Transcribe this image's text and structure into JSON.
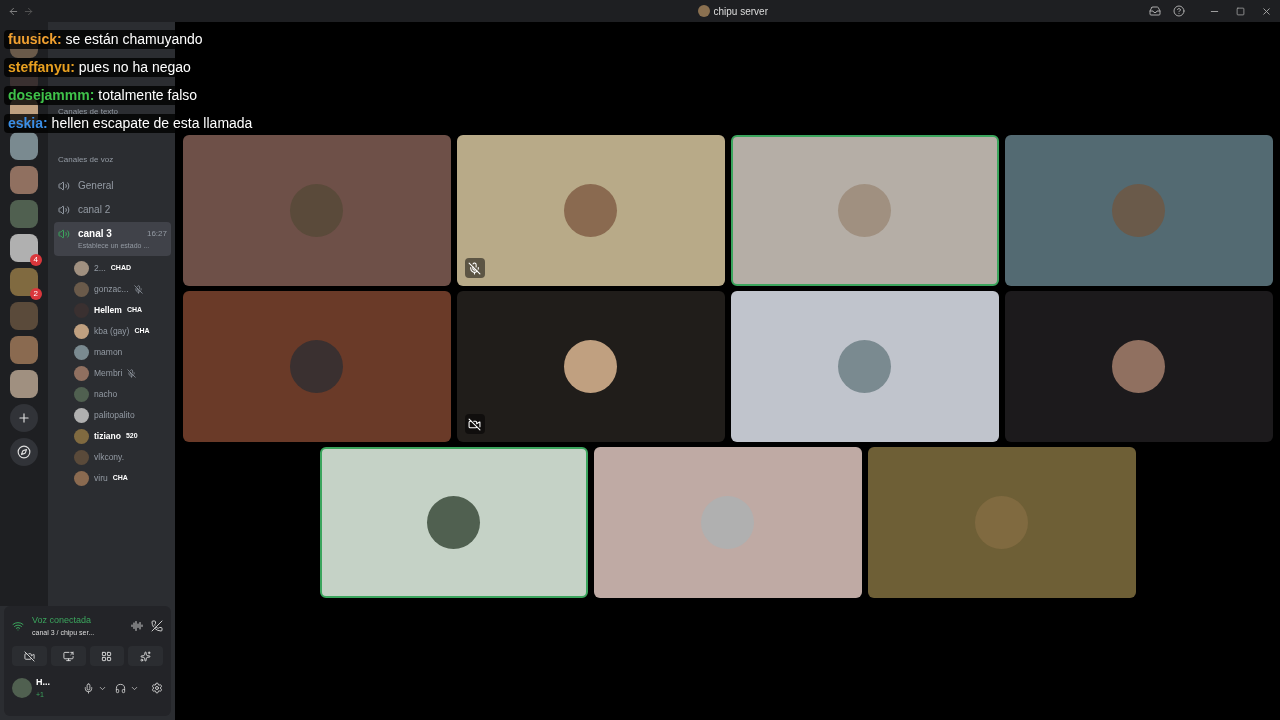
{
  "window": {
    "title": "chipu server"
  },
  "chat_overlay": [
    {
      "user": "fuusick:",
      "color": "#f0a030",
      "message": "se están chamuyando"
    },
    {
      "user": "steffanyu:",
      "color": "#e8a020",
      "message": "pues no ha negao"
    },
    {
      "user": "dosejammm:",
      "color": "#3fc24a",
      "message": "totalmente falso"
    },
    {
      "user": "eskia:",
      "color": "#3a8ee6",
      "message": "hellen escapate de esta llamada"
    }
  ],
  "servers": [
    {
      "kind": "server"
    },
    {
      "kind": "server"
    },
    {
      "kind": "server"
    },
    {
      "kind": "server"
    },
    {
      "kind": "server"
    },
    {
      "kind": "server"
    },
    {
      "kind": "server",
      "badge": "4"
    },
    {
      "kind": "server",
      "badge": "2"
    },
    {
      "kind": "server"
    },
    {
      "kind": "server"
    },
    {
      "kind": "server"
    }
  ],
  "sidebar": {
    "text_header": "Canales de texto",
    "voice_header": "Canales de voz",
    "channels": [
      {
        "name": "General",
        "selected": false
      },
      {
        "name": "canal 2",
        "selected": false
      },
      {
        "name": "canal 3",
        "selected": true,
        "time": "16:27",
        "status": "Establece un estado ..."
      }
    ],
    "members": [
      {
        "name": "2...",
        "highlighted": false,
        "tag": "CHAD",
        "muted": false
      },
      {
        "name": "gonzac...",
        "highlighted": false,
        "muted": true
      },
      {
        "name": "Hellem",
        "highlighted": true,
        "tag": "CHA",
        "muted": false
      },
      {
        "name": "kba (gay)",
        "highlighted": false,
        "tag": "CHA",
        "muted": false
      },
      {
        "name": "mamon",
        "highlighted": false,
        "muted": false
      },
      {
        "name": "Membri",
        "highlighted": false,
        "muted": true
      },
      {
        "name": "nacho",
        "highlighted": false,
        "muted": false
      },
      {
        "name": "palitopalito",
        "highlighted": false,
        "muted": false
      },
      {
        "name": "tiziano",
        "highlighted": true,
        "tag": "520",
        "muted": false
      },
      {
        "name": "vlkcony.",
        "highlighted": false,
        "muted": false
      },
      {
        "name": "viru",
        "highlighted": false,
        "tag": "CHA",
        "muted": false
      }
    ]
  },
  "voice_panel": {
    "status": "Voz conectada",
    "location": "canal 3 / chipu ser...",
    "user": "H...",
    "activity": "+1"
  },
  "tiles": [
    {
      "color": "#6e5048",
      "speaking": false,
      "muted": false,
      "camera_off": false
    },
    {
      "color": "#b8aa88",
      "speaking": false,
      "muted": true,
      "camera_off": false
    },
    {
      "color": "#b5aea6",
      "speaking": true,
      "muted": false,
      "camera_off": false
    },
    {
      "color": "#536a72",
      "speaking": false,
      "muted": false,
      "camera_off": false
    },
    {
      "color": "#6a3a28",
      "speaking": false,
      "muted": false,
      "camera_off": false
    },
    {
      "color": "#201d1a",
      "speaking": false,
      "muted": false,
      "camera_off": true
    },
    {
      "color": "#c0c4cc",
      "speaking": false,
      "muted": false,
      "camera_off": false
    },
    {
      "color": "#1c1a1c",
      "speaking": false,
      "muted": false,
      "camera_off": false
    },
    {
      "color": "#c5d2c6",
      "speaking": true,
      "muted": false,
      "camera_off": false
    },
    {
      "color": "#bfaaa4",
      "speaking": false,
      "muted": false,
      "camera_off": false
    },
    {
      "color": "#6e5f36",
      "speaking": false,
      "muted": false,
      "camera_off": false
    }
  ]
}
